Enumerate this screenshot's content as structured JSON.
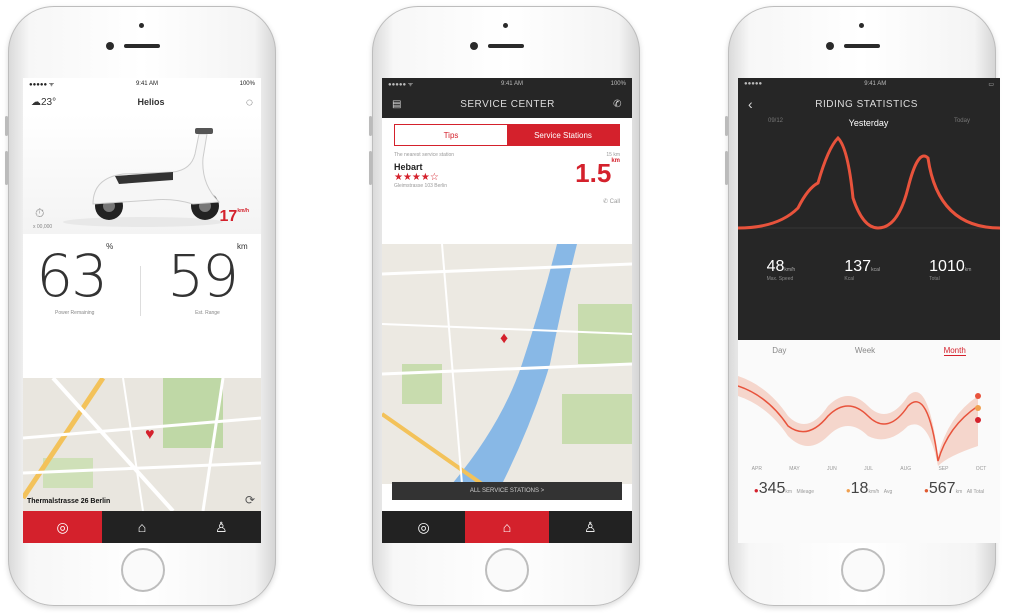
{
  "phone1": {
    "status": {
      "carrier": "●●●●● ᯤ",
      "time": "9:41 AM",
      "battery": "100%"
    },
    "weather": "23°",
    "title": "Helios",
    "speed": {
      "value": "17",
      "unit": "km/h"
    },
    "odometer": "x 00,000",
    "battery_percent": {
      "value": "63",
      "unit": "%",
      "label": "Power Remaining"
    },
    "range": {
      "value": "59",
      "unit": "km",
      "label": "Est. Range"
    },
    "address": "Thermalstrasse 26 Berlin",
    "tabs": [
      "dashboard",
      "toolbox",
      "profile"
    ]
  },
  "phone2": {
    "status": {
      "carrier": "●●●●● ᯤ",
      "time": "9:41 AM",
      "battery": "100%"
    },
    "title": "SERVICE CENTER",
    "segments": [
      "Tips",
      "Service Stations"
    ],
    "note": "The nearest service station",
    "note_right": "15 km",
    "station": {
      "name": "Hebart",
      "rating": "★★★★☆",
      "address": "Gleimstrasse 103 Berlin",
      "distance": "1.5",
      "distance_unit": "km",
      "phone": "Call"
    },
    "button": "ALL SERVICE STATIONS >",
    "tabs": [
      "dashboard",
      "toolbox",
      "profile"
    ]
  },
  "phone3": {
    "status": {
      "carrier": "●●●●●",
      "time": "9:41 AM",
      "battery": ""
    },
    "title": "RIDING STATISTICS",
    "days": [
      "09/12",
      "Yesterday",
      "Today"
    ],
    "metrics": [
      {
        "value": "48",
        "unit": "km/h",
        "label": "Max. Speed"
      },
      {
        "value": "137",
        "unit": "kcal",
        "label": "Kcal"
      },
      {
        "value": "1010",
        "unit": "km",
        "label": "Total"
      }
    ],
    "periods": [
      "Day",
      "Week",
      "Month"
    ],
    "months": [
      "APR",
      "MAY",
      "JUN",
      "JUL",
      "AUG",
      "SEP",
      "OCT"
    ],
    "totals": [
      {
        "value": "345",
        "unit": "km",
        "label": "Mileage",
        "color": "#d4212c"
      },
      {
        "value": "18",
        "unit": "km/h",
        "label": "Avg",
        "color": "#f0a050"
      },
      {
        "value": "567",
        "unit": "km",
        "label": "All Total",
        "color": "#e05a30"
      }
    ],
    "accent": "#d4212c"
  }
}
